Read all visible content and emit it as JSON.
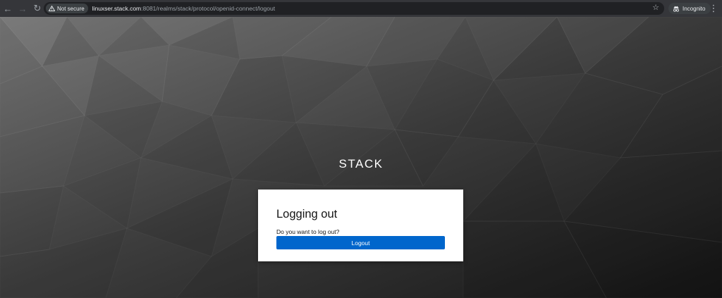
{
  "browser": {
    "security_label": "Not secure",
    "url_host": "linuxser.stack.com",
    "url_rest": ":8081/realms/stack/protocol/openid-connect/logout",
    "incognito_label": "Incognito",
    "icons": {
      "back": "arrow-left-icon",
      "forward": "arrow-right-icon",
      "reload": "reload-icon",
      "warning": "warning-triangle-icon",
      "bookmark": "star-icon",
      "incognito": "incognito-icon",
      "menu": "kebab-menu-icon"
    }
  },
  "page": {
    "brand": "STACK",
    "card": {
      "title": "Logging out",
      "message": "Do you want to log out?",
      "button_label": "Logout"
    },
    "colors": {
      "button": "#0066cc",
      "card": "#ffffff"
    }
  }
}
